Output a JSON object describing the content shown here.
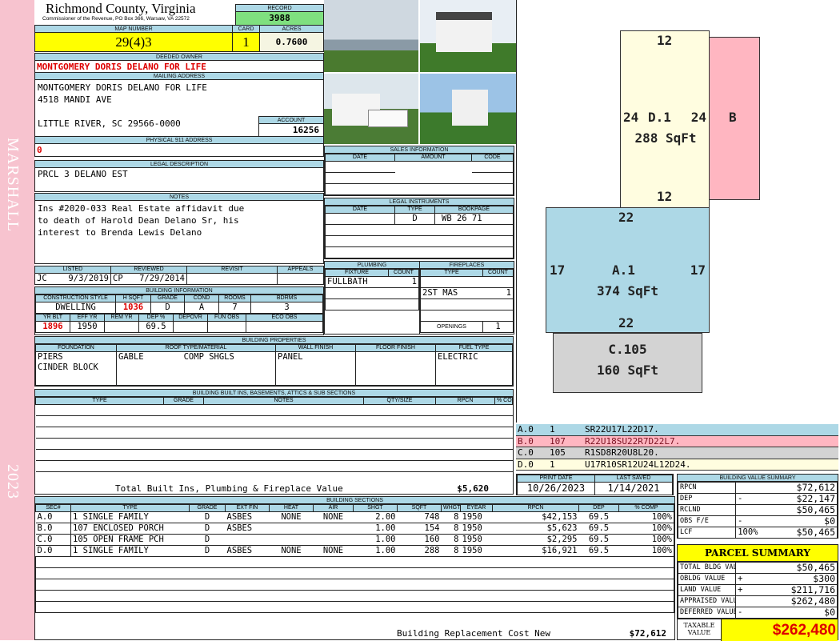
{
  "district": "MARSHALL",
  "year": "2023",
  "header": {
    "title": "Richmond County, Virginia",
    "subtitle": "Commissioner of the Revenue, PO Box 366, Warsaw, VA 22572"
  },
  "record": {
    "label": "RECORD",
    "value": "3988"
  },
  "map": {
    "map_label": "MAP NUMBER",
    "map_value": "29(4)3",
    "card_label": "CARD",
    "card_value": "1",
    "acres_label": "ACRES",
    "acres_value": "0.7600"
  },
  "owner": {
    "label": "DEEDED OWNER",
    "value": "MONTGOMERY DORIS DELANO FOR LIFE"
  },
  "mailing": {
    "label": "MAILING ADDRESS",
    "line1": "MONTGOMERY DORIS DELANO FOR LIFE",
    "line2": "4518 MANDI AVE",
    "line3": "LITTLE RIVER, SC 29566-0000"
  },
  "account": {
    "label": "ACCOUNT",
    "value": "16256"
  },
  "physical": {
    "label": "PHYSICAL 911 ADDRESS",
    "value": "0"
  },
  "legal": {
    "label": "LEGAL DESCRIPTION",
    "value": "PRCL 3 DELANO EST"
  },
  "notes": {
    "label": "NOTES",
    "line1": "Ins #2020-033 Real Estate affidavit due",
    "line2": "to death of Harold Dean Delano Sr, his",
    "line3": "interest to Brenda Lewis Delano"
  },
  "listed": {
    "headers": [
      "LISTED",
      "REVIEWED",
      "REVISIT",
      "APPEALS"
    ],
    "listed_by": "JC",
    "listed_date": "9/3/2019",
    "reviewed_by": "CP",
    "reviewed_date": "7/29/2014"
  },
  "building_info": {
    "label": "BUILDING INFORMATION",
    "headers1": [
      "CONSTRUCTION STYLE",
      "H SQFT",
      "GRADE",
      "COND",
      "ROOMS",
      "BDRMS"
    ],
    "row1": [
      "DWELLING",
      "1036",
      "D",
      "A",
      "7",
      "3"
    ],
    "headers2": [
      "YR BLT",
      "EFF YR",
      "REM YR",
      "DEP %",
      "DEPOVR",
      "FUN OBS",
      "ECO OBS"
    ],
    "row2": [
      "1896",
      "1950",
      "",
      "69.5",
      "",
      "",
      ""
    ]
  },
  "properties": {
    "label": "BUILDING PROPERTIES",
    "headers": [
      "FOUNDATION",
      "ROOF TYPE/MATERIAL",
      "WALL FINISH",
      "FLOOR FINISH",
      "FUEL TYPE"
    ],
    "foundation1": "PIERS",
    "foundation2": "CINDER BLOCK",
    "roof_type": "GABLE",
    "roof_material": "COMP SHGLS",
    "wall": "PANEL",
    "floor": "",
    "fuel": "ELECTRIC"
  },
  "builtins": {
    "label": "BUILDING BUILT INS, BASEMENTS, ATTICS & SUB SECTIONS",
    "headers": [
      "TYPE",
      "GRADE",
      "NOTES",
      "QTY/SIZE",
      "RPCN",
      "% COMP"
    ],
    "total_label": "Total Built Ins, Plumbing & Fireplace Value",
    "total_value": "$5,620"
  },
  "sales": {
    "label": "SALES INFORMATION",
    "headers": [
      "DATE",
      "AMOUNT",
      "CODE"
    ]
  },
  "instruments": {
    "label": "LEGAL INSTRUMENTS",
    "headers": [
      "DATE",
      "TYPE",
      "BOOKPAGE"
    ],
    "rows": [
      [
        "",
        "D",
        "WB 26 71"
      ]
    ]
  },
  "plumbing": {
    "label": "PLUMBING",
    "headers": [
      "FIXTURE",
      "COUNT"
    ],
    "rows": [
      [
        "FULLBATH",
        "1"
      ]
    ]
  },
  "fireplaces": {
    "label": "FIREPLACES",
    "headers": [
      "TYPE",
      "COUNT"
    ],
    "rows": [
      [
        "",
        ""
      ],
      [
        "2ST MAS",
        "1"
      ]
    ],
    "openings_label": "OPENINGS",
    "openings_value": "1"
  },
  "sections": {
    "label": "BUILDING SECTIONS",
    "headers": [
      "SEC#",
      "TYPE",
      "GRADE",
      "EXT FIN",
      "HEAT",
      "AIR",
      "SHGT",
      "SQFT",
      "WHGT",
      "EYEAR",
      "RPCN",
      "DEP",
      "% COMP"
    ],
    "rows": [
      [
        "A.0",
        "1 SINGLE FAMILY",
        "D",
        "ASBES",
        "NONE",
        "NONE",
        "2.00",
        "748",
        "8",
        "1950",
        "$42,153",
        "69.5",
        "100%"
      ],
      [
        "B.0",
        "107 ENCLOSED PORCH",
        "D",
        "ASBES",
        "",
        "",
        "1.00",
        "154",
        "8",
        "1950",
        "$5,623",
        "69.5",
        "100%"
      ],
      [
        "C.0",
        "105 OPEN FRAME PCH",
        "D",
        "",
        "",
        "",
        "1.00",
        "160",
        "8",
        "1950",
        "$2,295",
        "69.5",
        "100%"
      ],
      [
        "D.0",
        "1 SINGLE FAMILY",
        "D",
        "ASBES",
        "NONE",
        "NONE",
        "1.00",
        "288",
        "8",
        "1950",
        "$16,921",
        "69.5",
        "100%"
      ]
    ],
    "total_label": "Building Replacement Cost New",
    "total_value": "$72,612"
  },
  "sketch": {
    "D": {
      "top": "12",
      "left": "24",
      "right": "24",
      "bottom": "12",
      "name": "D.1",
      "area": "288 SqFt"
    },
    "B": {
      "name": "B"
    },
    "A": {
      "top": "22",
      "left": "17",
      "right": "17",
      "bottom": "22",
      "name": "A.1",
      "area": "374 SqFt"
    },
    "C": {
      "name": "C.105",
      "area": "160 SqFt"
    },
    "legend": [
      {
        "sec": "A.0",
        "code": "1",
        "path": "SR22U17L22D17.",
        "color": "#add8e6"
      },
      {
        "sec": "B.0",
        "code": "107",
        "path": "R22U18SU22R7D22L7.",
        "color": "#ffb6c1"
      },
      {
        "sec": "C.0",
        "code": "105",
        "path": "R1SD8R20U8L20.",
        "color": "#d3d3d3"
      },
      {
        "sec": "D.0",
        "code": "1",
        "path": "U17R10SR12U24L12D24.",
        "color": "#fffde0"
      }
    ]
  },
  "dates": {
    "print_label": "PRINT DATE",
    "print_value": "10/26/2023",
    "saved_label": "LAST SAVED",
    "saved_value": "1/14/2021"
  },
  "value_summary": {
    "label": "BUILDING VALUE SUMMARY",
    "rows": [
      {
        "name": "RPCN",
        "op": "",
        "value": "$72,612"
      },
      {
        "name": "DEP",
        "op": "-",
        "value": "$22,147"
      },
      {
        "name": "RCLND",
        "op": "",
        "value": "$50,465"
      },
      {
        "name": "OBS F/E",
        "op": "-",
        "value": "$0"
      },
      {
        "name": "LCF",
        "extra": "100%",
        "op": "",
        "value": "$50,465"
      }
    ]
  },
  "parcel": {
    "label": "PARCEL SUMMARY",
    "rows": [
      {
        "name": "TOTAL BLDG VALUE",
        "op": "",
        "value": "$50,465"
      },
      {
        "name": "OBLDG VALUE",
        "op": "+",
        "value": "$300"
      },
      {
        "name": "LAND VALUE",
        "op": "+",
        "value": "$211,716"
      },
      {
        "name": "APPRAISED VALUE",
        "op": "",
        "value": "$262,480"
      },
      {
        "name": "DEFERRED VALUE",
        "op": "-",
        "value": "$0"
      }
    ],
    "taxable_label": "TAXABLE VALUE",
    "taxable_value": "$262,480"
  },
  "colors": {
    "label_bg": "#add8e6",
    "highlight": "#ffff00",
    "record": "#7fe07f",
    "accent_red": "#dd0000"
  }
}
